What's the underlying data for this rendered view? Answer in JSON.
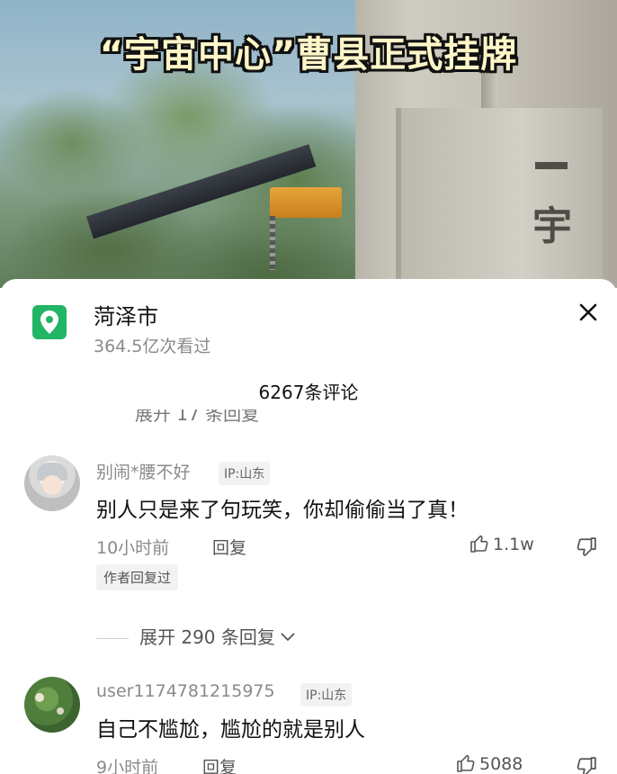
{
  "video": {
    "title": "“宇宙中心”曹县正式挂牌",
    "carved_text": "宇"
  },
  "location": {
    "name": "菏泽市",
    "views": "364.5亿次看过",
    "icon": "location-pin-icon",
    "accent": "#22b565"
  },
  "comments_header": {
    "count_text": "6267条评论"
  },
  "partial_above": "展开 17 条回复",
  "comments": [
    {
      "user": "别闹*腰不好",
      "ip": "IP:山东",
      "text": "别人只是来了句玩笑，你却偷偷当了真！",
      "time": "10小时前",
      "reply_label": "回复",
      "likes": "1.1w",
      "badge": "作者回复过",
      "expand_label": "展开 290 条回复"
    },
    {
      "user": "user1174781215975",
      "ip": "IP:山东",
      "text": "自己不尴尬，尴尬的就是别人",
      "time": "9小时前",
      "reply_label": "回复",
      "likes": "5088"
    }
  ]
}
